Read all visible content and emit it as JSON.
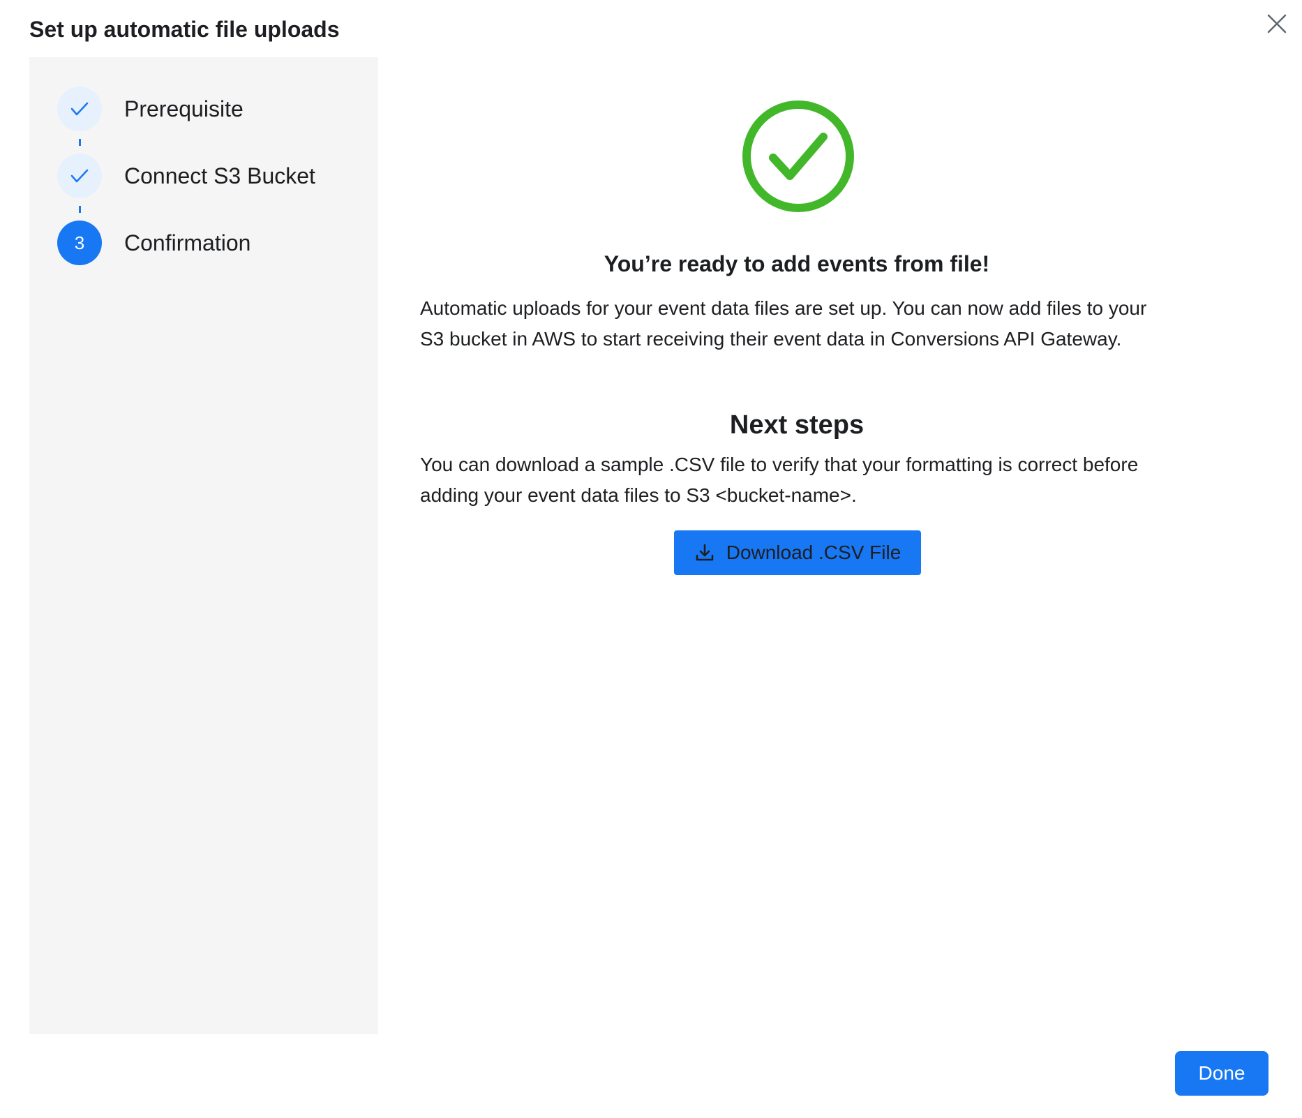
{
  "dialog": {
    "title": "Set up automatic file uploads",
    "close_icon": "close-icon"
  },
  "steps": [
    {
      "label": "Prerequisite",
      "status": "complete",
      "icon": "checkmark-icon"
    },
    {
      "label": "Connect S3 Bucket",
      "status": "complete",
      "icon": "checkmark-icon"
    },
    {
      "label": "Confirmation",
      "status": "active",
      "number": "3"
    }
  ],
  "confirmation": {
    "success_icon": "success-check-circle-icon",
    "title": "You’re ready to add events from file!",
    "body": "Automatic uploads for your event data files are set up. You can now add files to your S3 bucket in AWS to start receiving their event data in Conversions API Gateway."
  },
  "next_steps": {
    "title": "Next steps",
    "body": "You can download a sample .CSV file to verify that your formatting is correct before adding your event data files to S3 <bucket-name>.",
    "download_label": "Download .CSV File",
    "download_icon": "download-icon"
  },
  "footer": {
    "done_label": "Done"
  },
  "colors": {
    "accent": "#1877f2",
    "success": "#42b72a",
    "sidebar_bg": "#f5f5f5",
    "step_complete_bg": "#e7f1fd"
  }
}
